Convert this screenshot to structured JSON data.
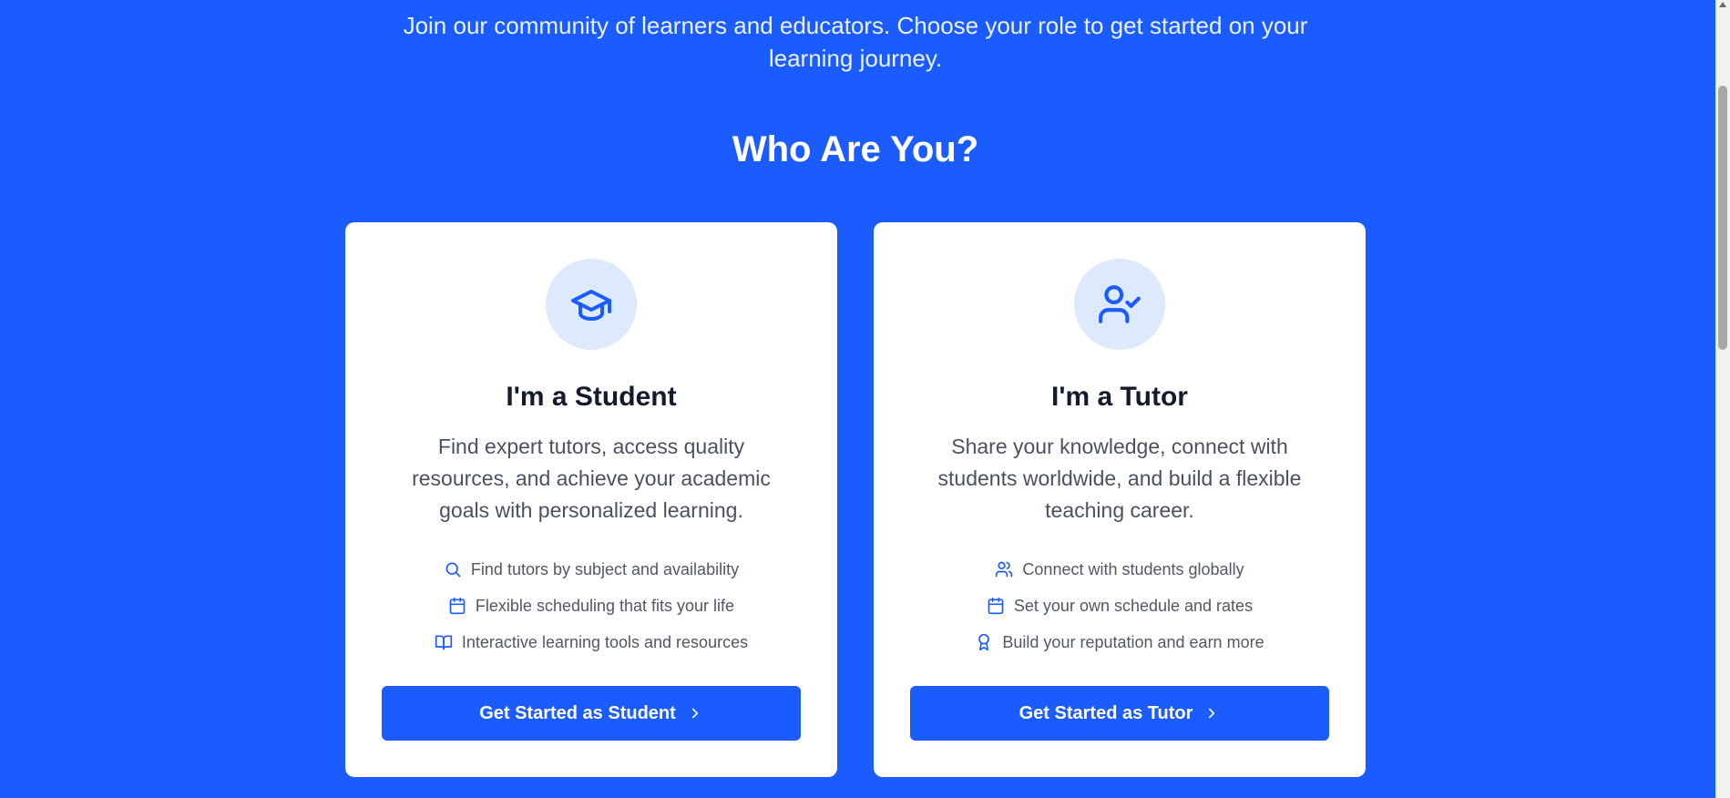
{
  "intro": {
    "line1": "Join our community of learners and educators. Choose your role to get started on your",
    "line2": "learning journey."
  },
  "section": {
    "title": "Who Are You?"
  },
  "cards": {
    "student": {
      "icon": "graduation-cap-icon",
      "title": "I'm a Student",
      "description": "Find expert tutors, access quality resources, and achieve your academic goals with personalized learning.",
      "features": [
        {
          "icon": "search-icon",
          "text": "Find tutors by subject and availability"
        },
        {
          "icon": "calendar-icon",
          "text": "Flexible scheduling that fits your life"
        },
        {
          "icon": "book-open-icon",
          "text": "Interactive learning tools and resources"
        }
      ],
      "cta": "Get Started as Student"
    },
    "tutor": {
      "icon": "user-check-icon",
      "title": "I'm a Tutor",
      "description": "Share your knowledge, connect with students worldwide, and build a flexible teaching career.",
      "features": [
        {
          "icon": "users-icon",
          "text": "Connect with students globally"
        },
        {
          "icon": "calendar-icon",
          "text": "Set your own schedule and rates"
        },
        {
          "icon": "award-icon",
          "text": "Build your reputation and earn more"
        }
      ],
      "cta": "Get Started as Tutor"
    }
  },
  "colors": {
    "background": "#1a5cff",
    "card": "#ffffff",
    "icon_circle": "#dde9fd",
    "accent": "#1a5cff",
    "title_text": "#141b2d",
    "body_text": "#4a5262"
  }
}
